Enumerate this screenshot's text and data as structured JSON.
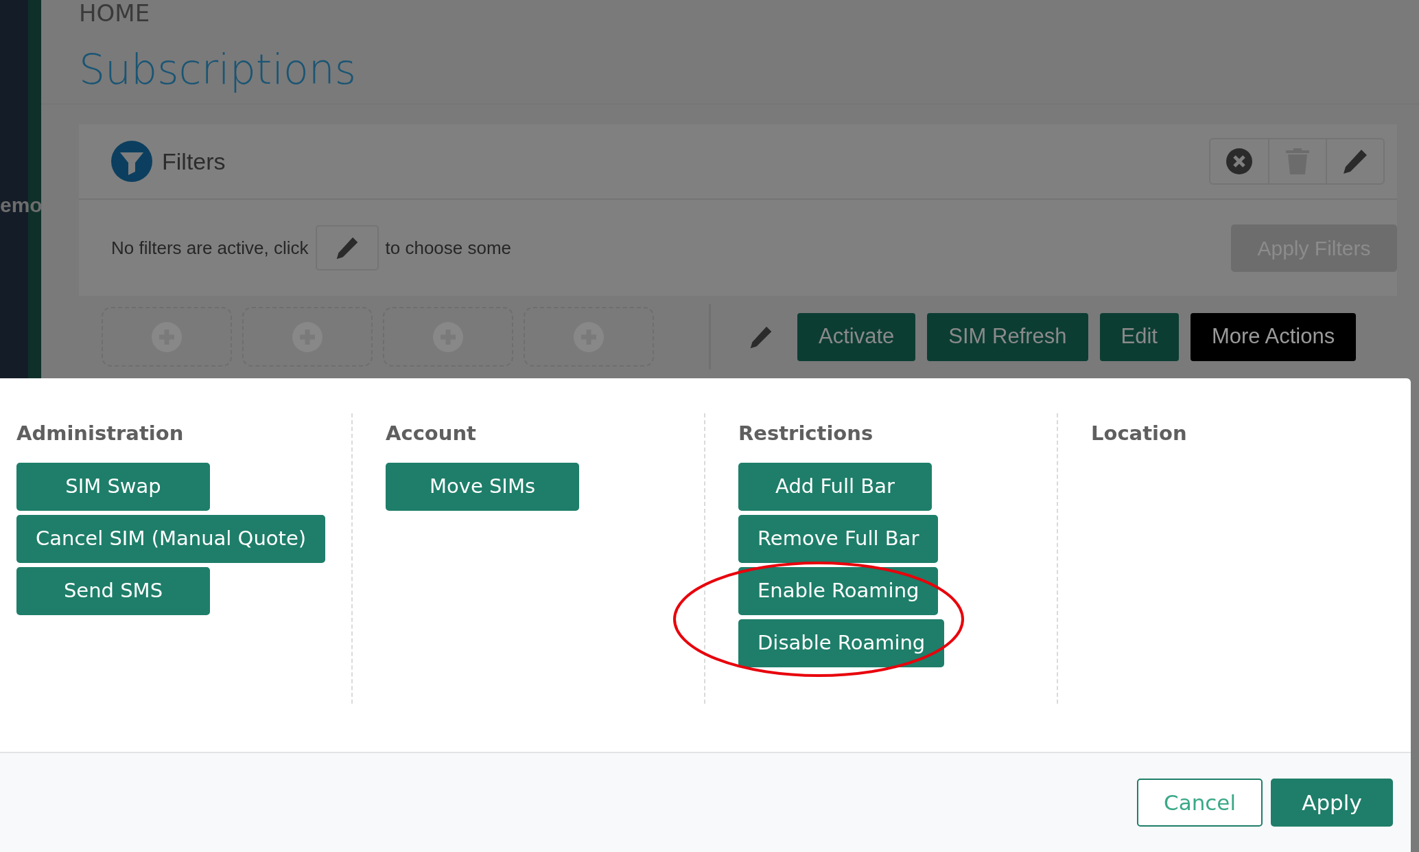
{
  "sidebar": {
    "label": "emo"
  },
  "breadcrumb": "HOME",
  "page_title": "Subscriptions",
  "filters": {
    "title": "Filters",
    "message_before": "No filters are active, click",
    "message_after": "to choose some",
    "apply_button": {
      "label": "Apply Filters",
      "disabled": true
    }
  },
  "actions": [
    {
      "label": "Activate",
      "kind": "primary"
    },
    {
      "label": "SIM Refresh",
      "kind": "primary"
    },
    {
      "label": "Edit",
      "kind": "primary"
    },
    {
      "label": "More Actions",
      "kind": "dark"
    }
  ],
  "modal": {
    "columns": [
      {
        "heading": "Administration",
        "buttons": [
          "SIM Swap",
          "Cancel SIM (Manual Quote)",
          "Send SMS"
        ]
      },
      {
        "heading": "Account",
        "buttons": [
          "Move SIMs"
        ]
      },
      {
        "heading": "Restrictions",
        "buttons": [
          "Add Full Bar",
          "Remove Full Bar",
          "Enable Roaming",
          "Disable Roaming"
        ]
      },
      {
        "heading": "Location"
      }
    ],
    "footer": {
      "cancel": "Cancel",
      "apply": "Apply"
    }
  }
}
